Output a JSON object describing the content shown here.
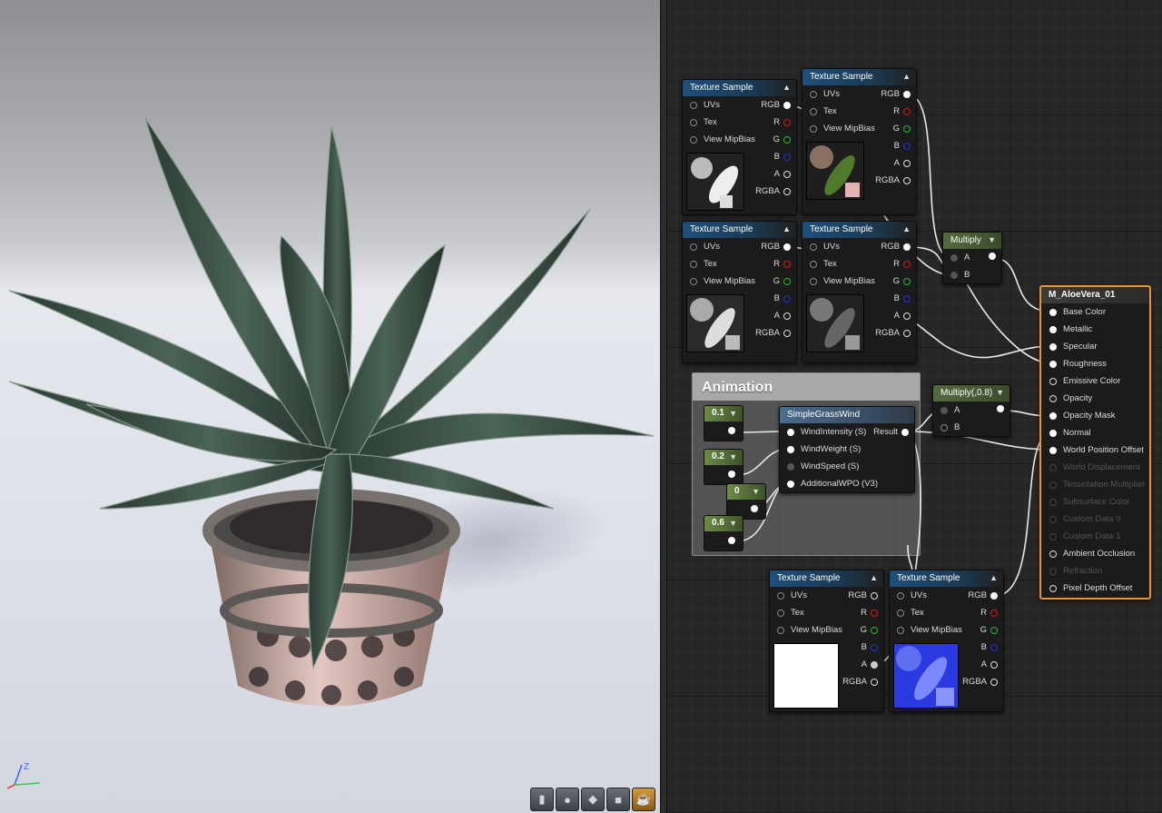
{
  "viewport": {
    "axis_label": "Z",
    "toolbar_icons": [
      "cylinder-icon",
      "sphere-icon",
      "plane-icon",
      "cube-icon",
      "teapot-icon"
    ]
  },
  "graph": {
    "nodes": {
      "ts1": {
        "title": "Texture Sample",
        "pins_in": [
          "UVs",
          "Tex",
          "View MipBias"
        ],
        "pins_out": [
          "RGB",
          "R",
          "G",
          "B",
          "A",
          "RGBA"
        ]
      },
      "ts2": {
        "title": "Texture Sample",
        "pins_in": [
          "UVs",
          "Tex",
          "View MipBias"
        ],
        "pins_out": [
          "RGB",
          "R",
          "G",
          "B",
          "A",
          "RGBA"
        ]
      },
      "ts3": {
        "title": "Texture Sample",
        "pins_in": [
          "UVs",
          "Tex",
          "View MipBias"
        ],
        "pins_out": [
          "RGB",
          "R",
          "G",
          "B",
          "A",
          "RGBA"
        ]
      },
      "ts4": {
        "title": "Texture Sample",
        "pins_in": [
          "UVs",
          "Tex",
          "View MipBias"
        ],
        "pins_out": [
          "RGB",
          "R",
          "G",
          "B",
          "A",
          "RGBA"
        ]
      },
      "ts5": {
        "title": "Texture Sample",
        "pins_in": [
          "UVs",
          "Tex",
          "View MipBias"
        ],
        "pins_out": [
          "RGB",
          "R",
          "G",
          "B",
          "A",
          "RGBA"
        ]
      },
      "ts6": {
        "title": "Texture Sample",
        "pins_in": [
          "UVs",
          "Tex",
          "View MipBias"
        ],
        "pins_out": [
          "RGB",
          "R",
          "G",
          "B",
          "A",
          "RGBA"
        ]
      },
      "multiply": {
        "title": "Multiply",
        "pins": [
          "A",
          "B"
        ]
      },
      "multiply08": {
        "title": "Multiply(,0.8)",
        "pins": [
          "A",
          "B"
        ]
      },
      "wind": {
        "title": "SimpleGrassWind",
        "pins_in": [
          "WindIntensity (S)",
          "WindWeight (S)",
          "WindSpeed (S)",
          "AdditionalWPO (V3)"
        ],
        "pin_out": "Result"
      },
      "const_a": {
        "value": "0.1"
      },
      "const_b": {
        "value": "0.2"
      },
      "const_c": {
        "value": "0"
      },
      "const_d": {
        "value": "0.6"
      }
    },
    "comment": {
      "title": "Animation"
    },
    "material": {
      "title": "M_AloeVera_01",
      "inputs": [
        {
          "label": "Base Color",
          "enabled": true
        },
        {
          "label": "Metallic",
          "enabled": true
        },
        {
          "label": "Specular",
          "enabled": true
        },
        {
          "label": "Roughness",
          "enabled": true
        },
        {
          "label": "Emissive Color",
          "enabled": true
        },
        {
          "label": "Opacity",
          "enabled": true
        },
        {
          "label": "Opacity Mask",
          "enabled": true
        },
        {
          "label": "Normal",
          "enabled": true
        },
        {
          "label": "World Position Offset",
          "enabled": true
        },
        {
          "label": "World Displacement",
          "enabled": false
        },
        {
          "label": "Tessellation Multiplier",
          "enabled": false
        },
        {
          "label": "Subsurface Color",
          "enabled": false
        },
        {
          "label": "Custom Data 0",
          "enabled": false
        },
        {
          "label": "Custom Data 1",
          "enabled": false
        },
        {
          "label": "Ambient Occlusion",
          "enabled": true
        },
        {
          "label": "Refraction",
          "enabled": false
        },
        {
          "label": "Pixel Depth Offset",
          "enabled": true
        }
      ]
    }
  }
}
